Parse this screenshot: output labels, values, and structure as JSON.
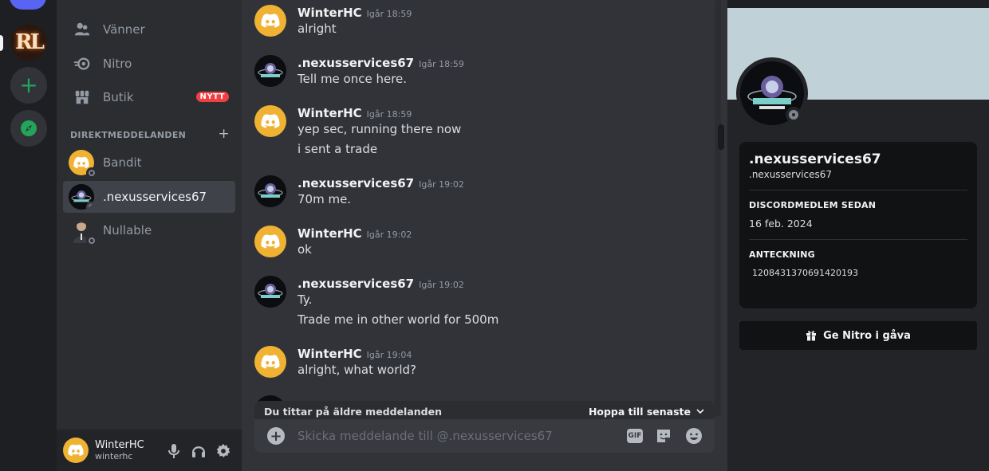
{
  "sidebar": {
    "nav": [
      {
        "label": "Vänner",
        "icon": "friends-icon"
      },
      {
        "label": "Nitro",
        "icon": "nitro-icon"
      },
      {
        "label": "Butik",
        "icon": "shop-icon",
        "badge": "NYTT"
      }
    ],
    "dm_header": "DIREKTMEDDELANDEN",
    "dms": [
      {
        "name": "Bandit",
        "active": false
      },
      {
        "name": ".nexusservices67",
        "active": true
      },
      {
        "name": "Nullable",
        "active": false
      }
    ]
  },
  "user": {
    "name": "WinterHC",
    "tag": "winterhc"
  },
  "messages": [
    {
      "author": "WinterHC",
      "time": "Igår 18:59",
      "lines": [
        "alright"
      ]
    },
    {
      "author": ".nexusservices67",
      "time": "Igår 18:59",
      "lines": [
        "Tell me once here."
      ]
    },
    {
      "author": "WinterHC",
      "time": "Igår 18:59",
      "lines": [
        "yep sec, running there now",
        "i sent a trade"
      ]
    },
    {
      "author": ".nexusservices67",
      "time": "Igår 19:02",
      "lines": [
        "70m me."
      ]
    },
    {
      "author": "WinterHC",
      "time": "Igår 19:02",
      "lines": [
        "ok"
      ]
    },
    {
      "author": ".nexusservices67",
      "time": "Igår 19:02",
      "lines": [
        "Ty.",
        "Trade me in other world for 500m"
      ]
    },
    {
      "author": "WinterHC",
      "time": "Igår 19:04",
      "lines": [
        "alright, what world?"
      ]
    }
  ],
  "older_bar": {
    "text": "Du tittar på äldre meddelanden",
    "jump": "Hoppa till senaste"
  },
  "composer": {
    "placeholder": "Skicka meddelande till @.nexusservices67",
    "gif": "GIF"
  },
  "profile": {
    "display_name": ".nexusservices67",
    "username": ".nexusservices67",
    "member_since_label": "DISCORDMEDLEM SEDAN",
    "member_since": "16 feb. 2024",
    "note_label": "ANTECKNING",
    "note": "1208431370691420193",
    "nitro_button": "Ge Nitro i gåva"
  },
  "colors": {
    "discord_avatar": "#f0b232",
    "accent": "#5865f2",
    "badge": "#f23f43",
    "banner": "#c0d1d8"
  }
}
